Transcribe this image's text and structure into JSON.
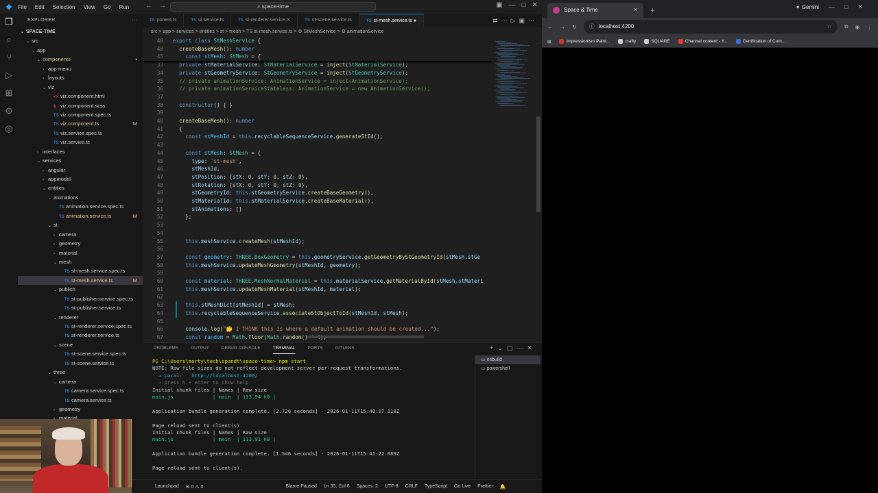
{
  "vscode": {
    "title": {
      "menu": [
        "File",
        "Edit",
        "Selection",
        "View",
        "Go",
        "Run"
      ],
      "command_center": "space-time"
    },
    "explorer": {
      "header": "EXPLORER",
      "root": "SPACE-TIME",
      "items": [
        {
          "label": "src",
          "depth": 0,
          "kind": "folder-open"
        },
        {
          "label": "app",
          "depth": 1,
          "kind": "folder-open"
        },
        {
          "label": "components",
          "depth": 2,
          "kind": "folder-open",
          "modified": true
        },
        {
          "label": "app-menu",
          "depth": 3,
          "kind": "folder"
        },
        {
          "label": "layouts",
          "depth": 3,
          "kind": "folder"
        },
        {
          "label": "viz",
          "depth": 3,
          "kind": "folder-open"
        },
        {
          "label": "viz.component.html",
          "depth": 4,
          "kind": "html"
        },
        {
          "label": "viz.component.scss",
          "depth": 4,
          "kind": "scss"
        },
        {
          "label": "viz.component.spec.ts",
          "depth": 4,
          "kind": "ts"
        },
        {
          "label": "viz.component.ts",
          "depth": 4,
          "kind": "ts",
          "modified": true,
          "badge": "M"
        },
        {
          "label": "viz.service.spec.ts",
          "depth": 4,
          "kind": "ts"
        },
        {
          "label": "viz.service.ts",
          "depth": 4,
          "kind": "ts"
        },
        {
          "label": "interfaces",
          "depth": 2,
          "kind": "folder"
        },
        {
          "label": "services",
          "depth": 2,
          "kind": "folder-open"
        },
        {
          "label": "angular",
          "depth": 3,
          "kind": "folder"
        },
        {
          "label": "appmodel",
          "depth": 3,
          "kind": "folder"
        },
        {
          "label": "entities",
          "depth": 3,
          "kind": "folder-open"
        },
        {
          "label": "animations",
          "depth": 4,
          "kind": "folder-open"
        },
        {
          "label": "animation.service.spec.ts",
          "depth": 5,
          "kind": "ts"
        },
        {
          "label": "animation.service.ts",
          "depth": 5,
          "kind": "ts",
          "modified": true,
          "badge": "M"
        },
        {
          "label": "st",
          "depth": 4,
          "kind": "folder-open"
        },
        {
          "label": "camera",
          "depth": 5,
          "kind": "folder"
        },
        {
          "label": "geometry",
          "depth": 5,
          "kind": "folder"
        },
        {
          "label": "material",
          "depth": 5,
          "kind": "folder"
        },
        {
          "label": "mesh",
          "depth": 5,
          "kind": "folder-open"
        },
        {
          "label": "st-mesh.service.spec.ts",
          "depth": 6,
          "kind": "ts"
        },
        {
          "label": "st-mesh.service.ts",
          "depth": 6,
          "kind": "ts",
          "modified": true,
          "badge": "M",
          "selected": true
        },
        {
          "label": "publish",
          "depth": 5,
          "kind": "folder-open"
        },
        {
          "label": "st-publisher.service.spec.ts",
          "depth": 6,
          "kind": "ts"
        },
        {
          "label": "st-publisher.service.ts",
          "depth": 6,
          "kind": "ts"
        },
        {
          "label": "renderer",
          "depth": 5,
          "kind": "folder-open"
        },
        {
          "label": "st-renderer.service.spec.ts",
          "depth": 6,
          "kind": "ts"
        },
        {
          "label": "st-renderer.service.ts",
          "depth": 6,
          "kind": "ts"
        },
        {
          "label": "scene",
          "depth": 5,
          "kind": "folder-open"
        },
        {
          "label": "st-scene.service.spec.ts",
          "depth": 6,
          "kind": "ts"
        },
        {
          "label": "st-scene.service.ts",
          "depth": 6,
          "kind": "ts"
        },
        {
          "label": "three",
          "depth": 4,
          "kind": "folder-open"
        },
        {
          "label": "camera",
          "depth": 5,
          "kind": "folder-open"
        },
        {
          "label": "camera.service.spec.ts",
          "depth": 6,
          "kind": "ts"
        },
        {
          "label": "camera.service.ts",
          "depth": 6,
          "kind": "ts"
        },
        {
          "label": "geometry",
          "depth": 5,
          "kind": "folder"
        },
        {
          "label": "material",
          "depth": 5,
          "kind": "folder"
        }
      ]
    },
    "tabs": [
      {
        "label": "ponent.ts",
        "active": false
      },
      {
        "label": "ui.service.ts",
        "active": false
      },
      {
        "label": "st-renderer.service.ts",
        "active": false
      },
      {
        "label": "st-scene.service.ts",
        "active": false
      },
      {
        "label": "st-mesh.service.ts",
        "active": true
      }
    ],
    "breadcrumb": "src > app > services > entities > st > mesh > TS st-mesh.service.ts > ⚙ StMeshService > ⚙ animationService",
    "panel": {
      "tabs": [
        "PROBLEMS",
        "OUTPUT",
        "DEBUG CONSOLE",
        "TERMINAL",
        "PORTS",
        "GITLENS"
      ],
      "terminal_lines": [
        "PS C:\\Users\\marty\\tech\\spandt\\space-time> npm start",
        "NOTE: Raw file sizes do not reflect development server per-request transformations.",
        "  → Local:   http://localhost:4200/",
        "  → press h + enter to show help",
        "Initial chunk files | Names | Raw size",
        "main.js             | main  | 113.94 kB |",
        "",
        "Application bundle generation complete. [2.726 seconds] - 2026-01-11T15:40:27.118Z",
        "",
        "Page reload sent to client(s).",
        "Initial chunk files | Names | Raw size",
        "main.js             | main  | 113.91 kB |",
        "",
        "Application bundle generation complete. [1.546 seconds] - 2026-01-11T15:41:22.089Z",
        "",
        "Page reload sent to client(s)."
      ],
      "terminals": [
        "esbuild",
        "powershell"
      ]
    },
    "status": {
      "launchpad": "Launchpad",
      "errors": "⊗ 0 ⚠ 0",
      "blame": "Blame Paused",
      "position": "Ln 35, Col 6",
      "spaces": "Spaces: 2",
      "encoding": "UTF-8",
      "eol": "CRLF",
      "language": "TypeScript",
      "golive": "Go Live",
      "prettier": "Prettier"
    }
  },
  "chrome": {
    "tab_title": "Space & Time",
    "gemini": "Gemini",
    "url": "localhost:4200",
    "bookmarks": [
      "Impressionism Paint...",
      "crafty",
      "SQUARE",
      "Channel content - Y...",
      "Certification of Com..."
    ]
  }
}
